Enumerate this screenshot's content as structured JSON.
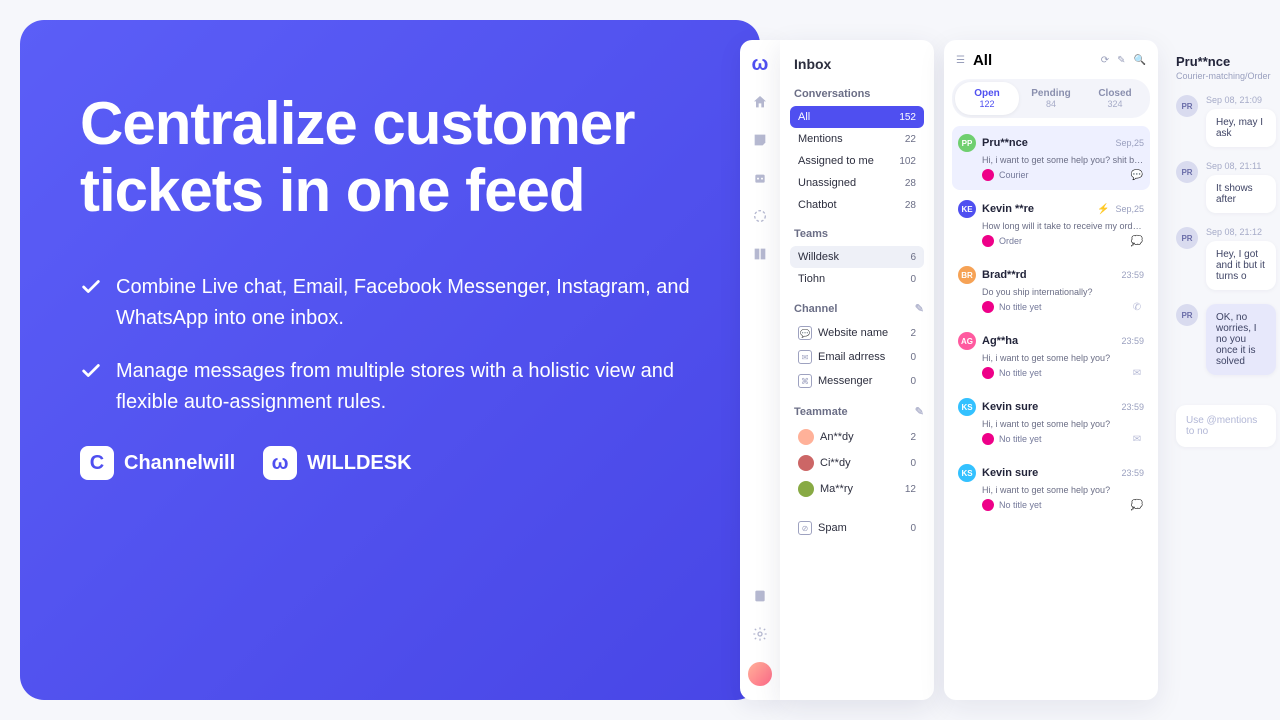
{
  "hero": {
    "headline": "Centralize customer tickets in one feed",
    "bullets": [
      "Combine Live chat, Email, Facebook Messenger, Instagram, and WhatsApp into one inbox.",
      "Manage messages from multiple stores with a holistic view and flexible auto-assignment rules."
    ],
    "brands": {
      "channelwill": "Channelwill",
      "willdesk": "WILLDESK"
    }
  },
  "inbox": {
    "title": "Inbox",
    "sections": {
      "conversations": "Conversations",
      "teams": "Teams",
      "channel": "Channel",
      "teammate": "Teammate"
    },
    "conversations": [
      {
        "label": "All",
        "count": 152,
        "active": true
      },
      {
        "label": "Mentions",
        "count": 22
      },
      {
        "label": "Assigned to me",
        "count": 102
      },
      {
        "label": "Unassigned",
        "count": 28
      },
      {
        "label": "Chatbot",
        "count": 28
      }
    ],
    "teams": [
      {
        "label": "Willdesk",
        "count": 6,
        "selected": true
      },
      {
        "label": "Tiohn",
        "count": 0
      }
    ],
    "channels": [
      {
        "label": "Website name",
        "count": 2
      },
      {
        "label": "Email adrress",
        "count": 0
      },
      {
        "label": "Messenger",
        "count": 0
      }
    ],
    "teammates": [
      {
        "label": "An**dy",
        "count": 2
      },
      {
        "label": "Ci**dy",
        "count": 0
      },
      {
        "label": "Ma**ry",
        "count": 12
      }
    ],
    "spam": {
      "label": "Spam",
      "count": 0
    }
  },
  "threads": {
    "title": "All",
    "tabs": [
      {
        "label": "Open",
        "count": 122,
        "on": true
      },
      {
        "label": "Pending",
        "count": 84
      },
      {
        "label": "Closed",
        "count": 324
      }
    ],
    "tickets": [
      {
        "initials": "PP",
        "color": "#6fcf6f",
        "name": "Pru**nce",
        "date": "Sep,25",
        "preview": "Hi, i want to get some help you? shit baa...",
        "tag": "Courier",
        "channel": "messenger",
        "selected": true
      },
      {
        "initials": "KE",
        "color": "#4f4ff0",
        "name": "Kevin **re",
        "date": "Sep,25",
        "preview": "How long will it take to receive my order?",
        "tag": "Order",
        "channel": "chat",
        "bolt": true
      },
      {
        "initials": "BR",
        "color": "#f6a255",
        "name": "Brad**rd",
        "date": "23:59",
        "preview": "Do you ship internationally?",
        "tag": "No title yet",
        "channel": "whatsapp"
      },
      {
        "initials": "AG",
        "color": "#ff5a9f",
        "name": "Ag**ha",
        "date": "23:59",
        "preview": "Hi, i want to get some help you?",
        "tag": "No title yet",
        "channel": "email"
      },
      {
        "initials": "KS",
        "color": "#33c1ff",
        "name": "Kevin sure",
        "date": "23:59",
        "preview": "Hi, i want to get some help you?",
        "tag": "No title yet",
        "channel": "email"
      },
      {
        "initials": "KS",
        "color": "#33c1ff",
        "name": "Kevin sure",
        "date": "23:59",
        "preview": "Hi, i want to get some help you?",
        "tag": "No title yet",
        "channel": "chat"
      }
    ]
  },
  "convo": {
    "title": "Pru**nce",
    "sub": "Courier-matching/Order",
    "messages": [
      {
        "ts": "Sep 08, 21:09",
        "text": "Hey, may I ask",
        "alt": false
      },
      {
        "ts": "Sep 08, 21:11",
        "text": "It shows after",
        "alt": false
      },
      {
        "ts": "Sep 08, 21:12",
        "text": "Hey, I got and it but it turns o",
        "alt": false
      },
      {
        "ts": "",
        "text": "OK, no worries, I no you once it is solved",
        "alt": true
      }
    ],
    "composer": "Use @mentions to no"
  }
}
